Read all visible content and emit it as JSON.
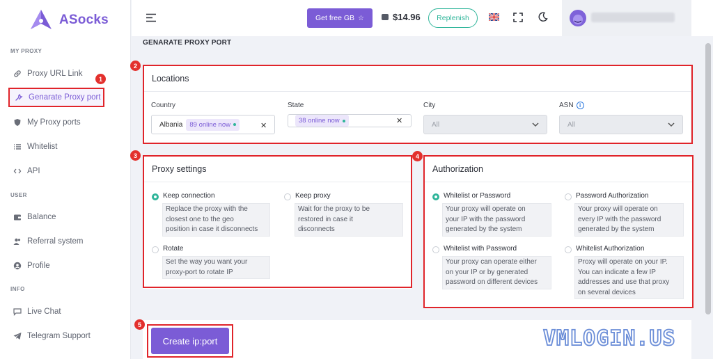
{
  "brand": {
    "name": "ASocks"
  },
  "sidebar": {
    "sections": {
      "my_proxy": "MY PROXY",
      "user": "USER",
      "info": "INFO"
    },
    "items": [
      {
        "label": "Proxy URL Link",
        "icon": "link-icon"
      },
      {
        "label": "Genarate Proxy port",
        "icon": "wrench-icon"
      },
      {
        "label": "My Proxy ports",
        "icon": "shield-icon"
      },
      {
        "label": "Whitelist",
        "icon": "list-icon"
      },
      {
        "label": "API",
        "icon": "code-icon"
      },
      {
        "label": "Balance",
        "icon": "wallet-icon"
      },
      {
        "label": "Referral system",
        "icon": "users-icon"
      },
      {
        "label": "Profile",
        "icon": "user-circle-icon"
      },
      {
        "label": "Live Chat",
        "icon": "chat-icon"
      },
      {
        "label": "Telegram Support",
        "icon": "telegram-icon"
      }
    ]
  },
  "topbar": {
    "get_gb": "Get free GB",
    "balance": "$14.96",
    "replenish": "Replenish"
  },
  "page": {
    "title": "GENARATE PROXY PORT"
  },
  "badges": [
    "1",
    "2",
    "3",
    "4",
    "5"
  ],
  "locations": {
    "title": "Locations",
    "country": {
      "label": "Country",
      "value": "Albania",
      "online": "89 online now"
    },
    "state": {
      "label": "State",
      "online": "38 online now"
    },
    "city": {
      "label": "City",
      "value": "All"
    },
    "asn": {
      "label": "ASN",
      "value": "All"
    }
  },
  "proxy_settings": {
    "title": "Proxy settings",
    "options": [
      {
        "label": "Keep connection",
        "desc": [
          "Replace the proxy with the",
          "closest one to the geo",
          "position in case it disconnects"
        ],
        "selected": true
      },
      {
        "label": "Keep proxy",
        "desc": [
          "Wait for the proxy to be",
          "restored in case it",
          "disconnects"
        ],
        "selected": false
      },
      {
        "label": "Rotate",
        "desc": [
          "Set the way you want your",
          "proxy-port to rotate IP"
        ],
        "selected": false
      }
    ]
  },
  "authorization": {
    "title": "Authorization",
    "options": [
      {
        "label": "Whitelist or Password",
        "desc": [
          "Your proxy will operate on",
          "your IP with the password",
          "generated by the system"
        ],
        "selected": true
      },
      {
        "label": "Password Authorization",
        "desc": [
          "Your proxy will operate on",
          "every IP with the password",
          "generated by the system"
        ],
        "selected": false
      },
      {
        "label": "Whitelist with Password",
        "desc": [
          "Your proxy can operate either",
          "on your IP or by generated",
          "password on different devices"
        ],
        "selected": false
      },
      {
        "label": "Whitelist Authorization",
        "desc": [
          "Proxy will operate on your IP.",
          "You can indicate a few IP",
          "addresses and use that proxy",
          "on several devices"
        ],
        "selected": false
      }
    ]
  },
  "create_button": "Create ip:port",
  "watermark": "VMLOGIN.US",
  "colors": {
    "accent": "#7b5cd6",
    "success": "#2fb59a",
    "highlight": "#e0242a"
  }
}
